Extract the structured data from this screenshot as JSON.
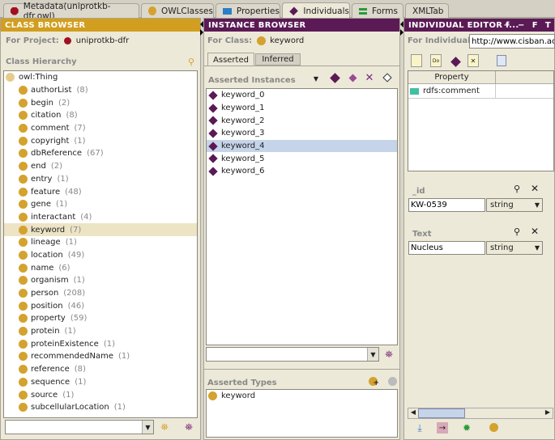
{
  "tabs": [
    {
      "label": "Metadata(uniprotkb-dfr.owl)",
      "icon": "metadata-icon",
      "active": false
    },
    {
      "label": "OWLClasses",
      "icon": "class-icon",
      "active": false
    },
    {
      "label": "Properties",
      "icon": "properties-icon",
      "active": false
    },
    {
      "label": "Individuals",
      "icon": "individual-icon",
      "active": true
    },
    {
      "label": "Forms",
      "icon": "forms-icon",
      "active": false
    },
    {
      "label": "XMLTab",
      "icon": "",
      "active": false
    }
  ],
  "class_browser": {
    "title": "CLASS BROWSER",
    "for_project_label": "For Project:",
    "project_name": "uniprotkb-dfr",
    "hierarchy_label": "Class Hierarchy",
    "root": "owl:Thing",
    "classes": [
      {
        "name": "authorList",
        "count": "(8)"
      },
      {
        "name": "begin",
        "count": "(2)"
      },
      {
        "name": "citation",
        "count": "(8)"
      },
      {
        "name": "comment",
        "count": "(7)"
      },
      {
        "name": "copyright",
        "count": "(1)"
      },
      {
        "name": "dbReference",
        "count": "(67)"
      },
      {
        "name": "end",
        "count": "(2)"
      },
      {
        "name": "entry",
        "count": "(1)"
      },
      {
        "name": "feature",
        "count": "(48)"
      },
      {
        "name": "gene",
        "count": "(1)"
      },
      {
        "name": "interactant",
        "count": "(4)"
      },
      {
        "name": "keyword",
        "count": "(7)",
        "selected": true
      },
      {
        "name": "lineage",
        "count": "(1)"
      },
      {
        "name": "location",
        "count": "(49)"
      },
      {
        "name": "name",
        "count": "(6)"
      },
      {
        "name": "organism",
        "count": "(1)"
      },
      {
        "name": "person",
        "count": "(208)"
      },
      {
        "name": "position",
        "count": "(46)"
      },
      {
        "name": "property",
        "count": "(59)"
      },
      {
        "name": "protein",
        "count": "(1)"
      },
      {
        "name": "proteinExistence",
        "count": "(1)"
      },
      {
        "name": "recommendedName",
        "count": "(1)"
      },
      {
        "name": "reference",
        "count": "(8)"
      },
      {
        "name": "sequence",
        "count": "(1)"
      },
      {
        "name": "source",
        "count": "(1)"
      },
      {
        "name": "subcellularLocation",
        "count": "(1)"
      }
    ],
    "search_value": ""
  },
  "instance_browser": {
    "title": "INSTANCE BROWSER",
    "for_class_label": "For Class:",
    "class_name": "keyword",
    "tabs": [
      "Asserted",
      "Inferred"
    ],
    "instances_label": "Asserted Instances",
    "instances": [
      "keyword_0",
      "keyword_1",
      "keyword_2",
      "keyword_3",
      "keyword_4",
      "keyword_5",
      "keyword_6"
    ],
    "selected_index": 4,
    "search_value": "",
    "types_label": "Asserted Types",
    "types": [
      "keyword"
    ]
  },
  "individual_editor": {
    "title": "INDIVIDUAL EDITOR f...",
    "header_buttons": [
      "+",
      "−",
      "F",
      "T"
    ],
    "for_individual_label": "For Individual:",
    "individual_uri": "http://www.cisban.ac",
    "table_header": [
      "Property",
      ""
    ],
    "properties": [
      {
        "name": "rdfs:comment",
        "value": ""
      }
    ],
    "fields": [
      {
        "label": "_id",
        "value": "KW-0539",
        "type": "string"
      },
      {
        "label": "Text",
        "value": "Nucleus",
        "type": "string"
      }
    ]
  }
}
